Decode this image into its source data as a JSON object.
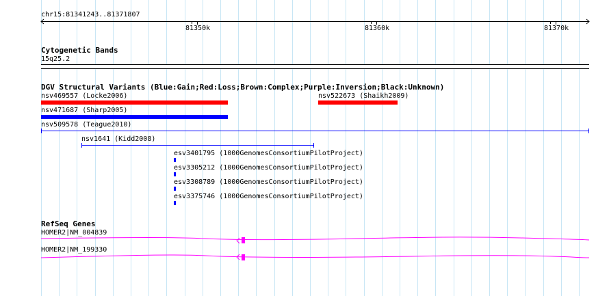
{
  "ruler": {
    "region": "chr15:81341243..81371807",
    "ticks": [
      "81350k",
      "81360k",
      "81370k"
    ]
  },
  "tracks": {
    "cytoband": {
      "title": "Cytogenetic Bands",
      "band": "15q25.2"
    },
    "dgv": {
      "title": "DGV Structural Variants (Blue:Gain;Red:Loss;Brown:Complex;Purple:Inversion;Black:Unknown)",
      "colors": {
        "loss": "#ff0000",
        "gain": "#0000ff",
        "unknown": "#0000ff"
      },
      "features": [
        {
          "label": "nsv469557 (Locke2006)",
          "type": "loss"
        },
        {
          "label": "nsv522673 (Shaikh2009)",
          "type": "loss"
        },
        {
          "label": "nsv471687 (Sharp2005)",
          "type": "gain"
        },
        {
          "label": "nsv509578 (Teague2010)",
          "type": "line"
        },
        {
          "label": "nsv1641 (Kidd2008)",
          "type": "line"
        },
        {
          "label": "esv3401795 (1000GenomesConsortiumPilotProject)",
          "type": "tick"
        },
        {
          "label": "esv3305212 (1000GenomesConsortiumPilotProject)",
          "type": "tick"
        },
        {
          "label": "esv3308789 (1000GenomesConsortiumPilotProject)",
          "type": "tick"
        },
        {
          "label": "esv3375746 (1000GenomesConsortiumPilotProject)",
          "type": "tick"
        }
      ]
    },
    "refseq": {
      "title": "RefSeq Genes",
      "color": "#ff00ff",
      "genes": [
        {
          "label": "HOMER2|NM_004839"
        },
        {
          "label": "HOMER2|NM_199330"
        }
      ]
    }
  }
}
